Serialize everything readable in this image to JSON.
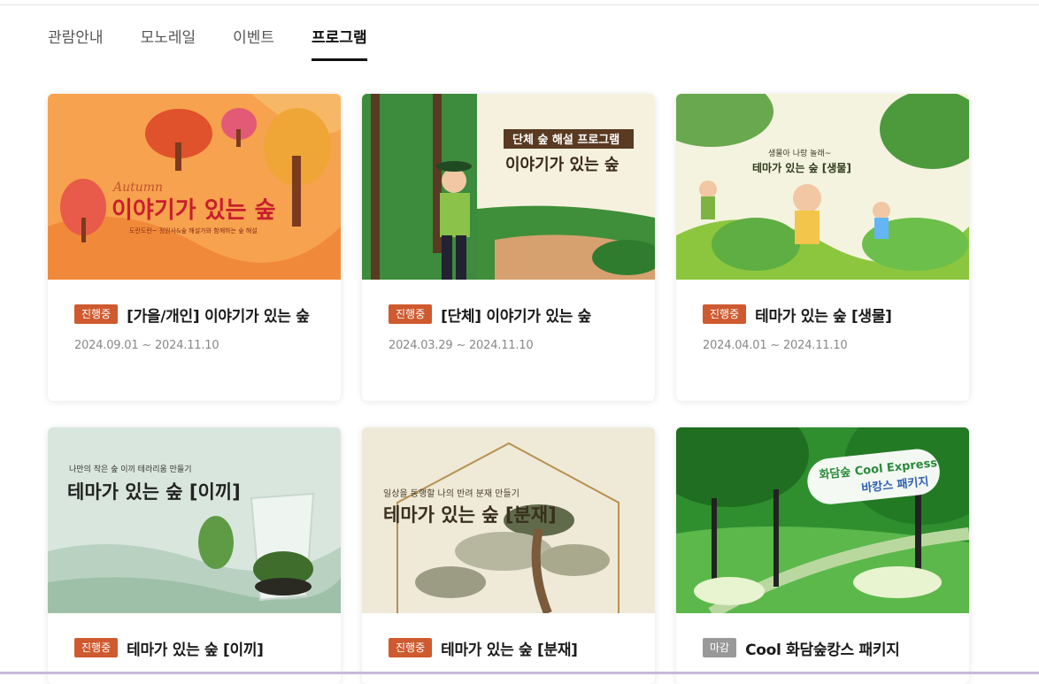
{
  "tabs": [
    {
      "label": "관람안내",
      "active": false
    },
    {
      "label": "모노레일",
      "active": false
    },
    {
      "label": "이벤트",
      "active": false
    },
    {
      "label": "프로그램",
      "active": true
    }
  ],
  "cards": [
    {
      "status": "진행중",
      "title": "[가을/개인] 이야기가 있는 숲",
      "period": "2024.09.01 ~ 2024.11.10",
      "image": {
        "script": "Autumn",
        "headline": "이야기가 있는 숲",
        "caption": "도란도란~ 정원사&숲 해설가와 함께하는 숲 해설"
      }
    },
    {
      "status": "진행중",
      "title": "[단체] 이야기가 있는 숲",
      "period": "2024.03.29 ~ 2024.11.10",
      "image": {
        "tag": "단체 숲 해설 프로그램",
        "headline": "이야기가 있는 숲"
      }
    },
    {
      "status": "진행중",
      "title": "테마가 있는 숲 [생물]",
      "period": "2024.04.01 ~ 2024.11.10",
      "image": {
        "sub": "생물아 나랑 놀래~",
        "headline": "테마가 있는 숲 [생물]"
      }
    },
    {
      "status": "진행중",
      "title": "테마가 있는 숲 [이끼]",
      "image": {
        "sub": "나만의 작은 숲 이끼 테라리움 만들기",
        "headline": "테마가 있는 숲 [이끼]"
      }
    },
    {
      "status": "진행중",
      "title": "테마가 있는 숲 [분재]",
      "image": {
        "sub": "일상을 동행할 나의 반려 분재 만들기",
        "headline": "테마가 있는 숲 [분재]"
      }
    },
    {
      "status": "마감",
      "title": "Cool 화담숲캉스 패키지",
      "image": {
        "line1": "화담숲 Cool Express",
        "line2": "바캉스 패키지"
      }
    }
  ],
  "colors": {
    "badge_active": "#cf5a2f",
    "badge_closed": "#999999",
    "tab_active": "#111111"
  }
}
